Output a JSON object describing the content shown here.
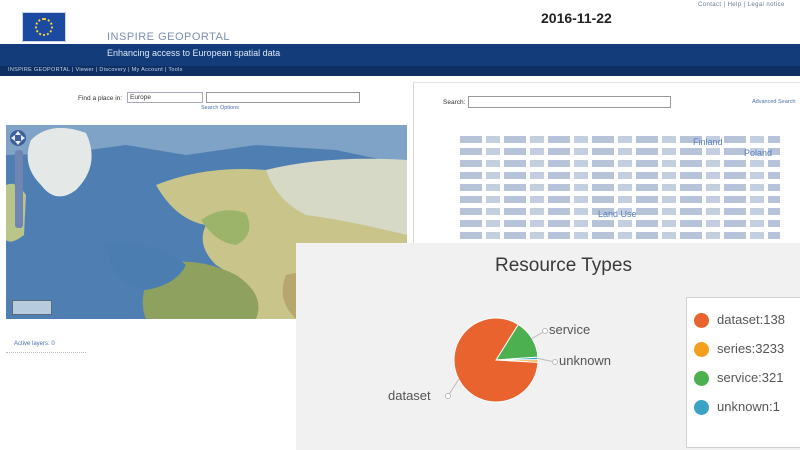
{
  "header": {
    "app_title": "INSPIRE GEOPORTAL",
    "tagline": "Enhancing access to European spatial data",
    "date": "2016-11-22",
    "top_links": "Contact | Help | Legal notice"
  },
  "nav": {
    "items_text": "INSPIRE GEOPORTAL  |  Viewer  |  Discovery  |  My Account  |  Tools"
  },
  "map_panel": {
    "find_place_label": "Find a place in:",
    "place_select_value": "Europe",
    "search_options_link": "Search Options",
    "active_layers_link": "Active layers: 0"
  },
  "metadata_panel": {
    "search_label": "Search:",
    "advanced_link": "Advanced Search",
    "tag_highlights": [
      "Finland",
      "Poland",
      "Land Use"
    ]
  },
  "resource_types": {
    "title": "Resource Types",
    "pie_labels": [
      "service",
      "unknown",
      "dataset"
    ],
    "legend": [
      {
        "text": "dataset:138",
        "color": "#e8632e"
      },
      {
        "text": "series:3233",
        "color": "#f5a01c"
      },
      {
        "text": "service:321",
        "color": "#4caf50"
      },
      {
        "text": "unknown:1",
        "color": "#3ba3c4"
      }
    ]
  },
  "chart_data": {
    "type": "pie",
    "title": "Resource Types",
    "categories": [
      "dataset",
      "series",
      "service",
      "unknown"
    ],
    "values": [
      83,
      1,
      15,
      1
    ],
    "legend_position": "right"
  }
}
